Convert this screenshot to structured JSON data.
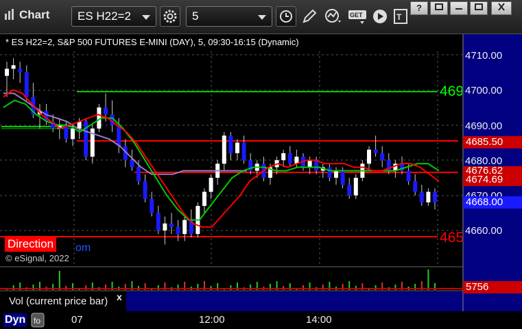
{
  "window": {
    "title": "Chart",
    "symbol": "ES H22=2",
    "interval": "5",
    "help_label": "?",
    "controls": [
      "?",
      "restore",
      "maximize",
      "close"
    ]
  },
  "chart": {
    "header": "* ES H22=2, S&P 500 FUTURES E-MINI (DAY), 5, 09:30-16:15 (Dynamic)",
    "copyright": "© eSignal, 2022",
    "direction_label": "Direction",
    "direction_suffix": "om",
    "price_axis": [
      "4710.00",
      "4700.00",
      "4690.00",
      "4680.00",
      "4670.00",
      "4660.00"
    ],
    "level_labels": {
      "green": "469",
      "red_low": "465"
    },
    "price_tags": {
      "resistance": "4685.50",
      "red_line": "4676.62",
      "red_ma": "4674.69",
      "last": "4668.00",
      "volume": "5756"
    },
    "time_axis": [
      "07",
      "12:00",
      "14:00"
    ],
    "colors": {
      "background": "#000000",
      "up_candle": "#ffffff",
      "down_candle": "#1a1aff",
      "green_line": "#00cc00",
      "red_line": "#ff0000",
      "purple_ma": "#9a7fc8",
      "panel_blue": "#000080"
    }
  },
  "volume_panel": {
    "label": "Vol (current price bar)",
    "close": "x"
  },
  "dyn_label": "Dyn"
}
